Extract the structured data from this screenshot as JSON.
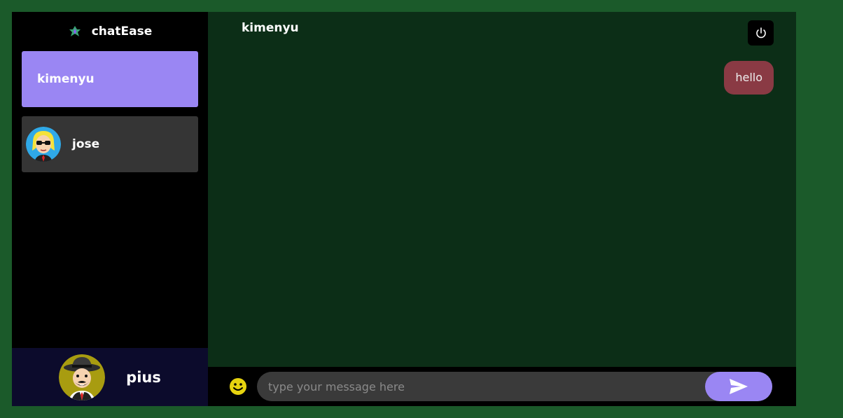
{
  "app": {
    "name": "chatEase"
  },
  "contacts": [
    {
      "name": "kimenyu",
      "active": true
    },
    {
      "name": "jose",
      "active": false
    }
  ],
  "current_user": {
    "name": "pius"
  },
  "chat": {
    "title": "kimenyu",
    "messages": [
      {
        "text": "hello",
        "direction": "sent"
      }
    ]
  },
  "composer": {
    "placeholder": "type your message here"
  },
  "colors": {
    "page_bg": "#1b5a2a",
    "sidebar_bg": "#000000",
    "accent": "#9a86f3",
    "chat_bg": "#0c2e17",
    "sent_bubble": "#8a3a44",
    "user_panel": "#0c0b2c"
  },
  "icons": {
    "brand": "chatEase-logo-icon",
    "logout": "power-icon",
    "emoji": "smiley-icon",
    "send": "paper-plane-icon"
  }
}
